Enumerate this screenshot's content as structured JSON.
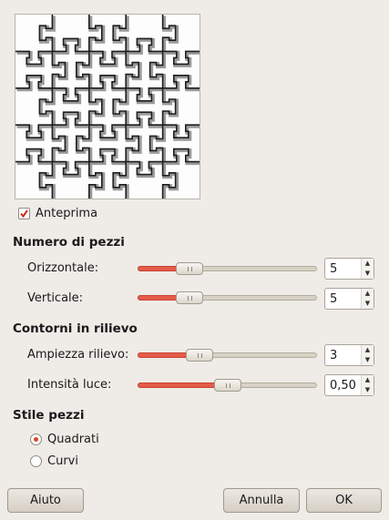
{
  "preview_toggle": {
    "label": "Anteprima",
    "checked": true
  },
  "pieces": {
    "title": "Numero di pezzi",
    "horizontal": {
      "label": "Orizzontale:",
      "value": "5",
      "fraction": 0.25
    },
    "vertical": {
      "label": "Verticale:",
      "value": "5",
      "fraction": 0.25
    }
  },
  "bevel": {
    "title": "Contorni in rilievo",
    "width": {
      "label": "Ampiezza rilievo:",
      "value": "3",
      "fraction": 0.32
    },
    "highlight": {
      "label": "Intensità luce:",
      "value": "0,50",
      "fraction": 0.5
    }
  },
  "style": {
    "title": "Stile pezzi",
    "options": [
      {
        "label": "Quadrati",
        "selected": true
      },
      {
        "label": "Curvi",
        "selected": false
      }
    ]
  },
  "buttons": {
    "help": "Aiuto",
    "cancel": "Annulla",
    "ok": "OK"
  },
  "colors": {
    "accent": "#e35c4a",
    "window_bg": "#efebe7"
  },
  "icons": {
    "checkbox_mark": "check-icon",
    "spin_up": "arrow-up-icon",
    "spin_down": "arrow-down-icon"
  }
}
